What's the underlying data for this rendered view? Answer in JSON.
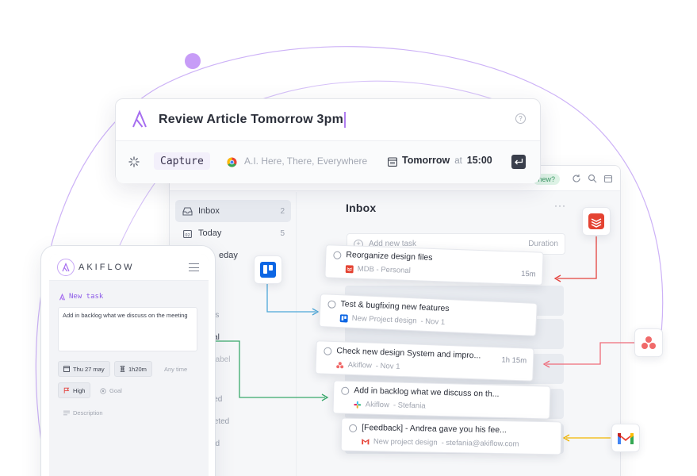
{
  "capture": {
    "input_text": "Review Article Tomorrow 3pm",
    "help_symbol": "?",
    "mode_chip": "Capture",
    "hint": "A.I. Here, There, Everywhere",
    "date_label": "Tomorrow",
    "at_label": "at",
    "time_label": "15:00"
  },
  "desktop": {
    "new_pill": "new?",
    "sidebar": {
      "items": [
        {
          "label": "Inbox",
          "count": "2"
        },
        {
          "label": "Today",
          "count": "5"
        },
        {
          "label": "eday",
          "count": ""
        }
      ],
      "fragments": [
        "ings",
        "onal",
        "Label",
        "ized",
        "pleted",
        "ed"
      ]
    },
    "main": {
      "title": "Inbox",
      "more": "···",
      "add_task_placeholder": "Add new task",
      "duration_label": "Duration"
    }
  },
  "tasks": [
    {
      "title": "Reorganize design files",
      "source": "MDB - Personal",
      "date": "",
      "duration": "15m",
      "icon": "todoist-icon"
    },
    {
      "title": "Test & bugfixing new features",
      "source": "New Project design",
      "date": "- Nov 1",
      "duration": "",
      "icon": "trello-icon"
    },
    {
      "title": "Check new design System and impro...",
      "source": "Akiflow",
      "date": "- Nov 1",
      "duration": "1h 15m",
      "icon": "asana-icon"
    },
    {
      "title": "Add in backlog what we discuss on th...",
      "source": "Akiflow",
      "date": "- Stefania",
      "duration": "",
      "icon": "slack-icon"
    },
    {
      "title": "[Feedback] - Andrea gave you his fee...",
      "source": "New project design",
      "date": "- stefania@akiflow.com",
      "duration": "",
      "icon": "gmail-icon"
    }
  ],
  "mobile": {
    "brand": "AKIFLOW",
    "new_task_label": "New task",
    "task_text": "Add in backlog what we discuss on the meeting",
    "date_chip": "Thu 27 may",
    "duration_chip": "1h20m",
    "anytime": "Any time",
    "priority_chip": "High",
    "goal": "Goal",
    "description": "Description"
  },
  "colors": {
    "accent": "#a66ef0",
    "todoist": "#e44332",
    "trello": "#0c66e4",
    "asana": "#f06a6a",
    "gmail_arrow": "#f2b600",
    "trello_arrow": "#4ea7d8",
    "green_arrow": "#39a86b"
  }
}
